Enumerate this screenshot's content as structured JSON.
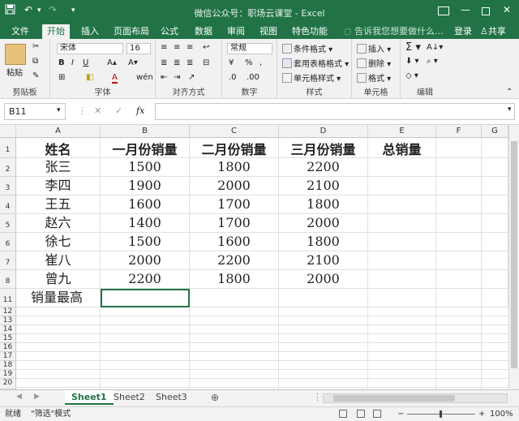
{
  "title": "微信公众号：职场云课堂 - Excel",
  "quick_access": [
    "save-icon",
    "undo-icon",
    "redo-icon"
  ],
  "tabs": [
    "文件",
    "开始",
    "插入",
    "页面布局",
    "公式",
    "数据",
    "审阅",
    "视图",
    "特色功能"
  ],
  "active_tab": "开始",
  "tell_me": "告诉我您想要做什么...",
  "login": "登录",
  "share": "共享",
  "ribbon": {
    "clipboard": {
      "label": "剪贴板",
      "paste": "粘贴"
    },
    "font": {
      "label": "字体",
      "name": "宋体",
      "size": "16"
    },
    "alignment": {
      "label": "对齐方式"
    },
    "number": {
      "label": "数字",
      "format": "常规"
    },
    "styles": {
      "label": "样式",
      "conditional": "条件格式",
      "table": "套用表格格式",
      "cell": "单元格样式"
    },
    "cells": {
      "label": "单元格",
      "insert": "插入",
      "delete": "删除",
      "format": "格式"
    },
    "editing": {
      "label": "编辑"
    }
  },
  "name_box": "B11",
  "fx_label": "fx",
  "columns": [
    "A",
    "B",
    "C",
    "D",
    "E",
    "F",
    "G"
  ],
  "rows": [
    "1",
    "2",
    "3",
    "4",
    "5",
    "6",
    "7",
    "8",
    "11",
    "12",
    "13",
    "14",
    "15",
    "16",
    "17",
    "18",
    "19",
    "20"
  ],
  "table": {
    "header": [
      "姓名",
      "一月份销量",
      "二月份销量",
      "三月份销量",
      "总销量"
    ],
    "data": [
      [
        "张三",
        "1500",
        "1800",
        "2200",
        ""
      ],
      [
        "李四",
        "1900",
        "2000",
        "2100",
        ""
      ],
      [
        "王五",
        "1600",
        "1700",
        "1800",
        ""
      ],
      [
        "赵六",
        "1400",
        "1700",
        "2000",
        ""
      ],
      [
        "徐七",
        "1500",
        "1600",
        "1800",
        ""
      ],
      [
        "崔八",
        "2000",
        "2200",
        "2100",
        ""
      ],
      [
        "曾九",
        "2200",
        "1800",
        "2000",
        ""
      ]
    ],
    "footer": "销量最高"
  },
  "sheets": [
    "Sheet1",
    "Sheet2",
    "Sheet3"
  ],
  "active_sheet": "Sheet1",
  "status": {
    "mode": "就绪",
    "filter_mode": "\"筛选\"模式",
    "zoom": "100%"
  },
  "colors": {
    "accent": "#217346"
  }
}
